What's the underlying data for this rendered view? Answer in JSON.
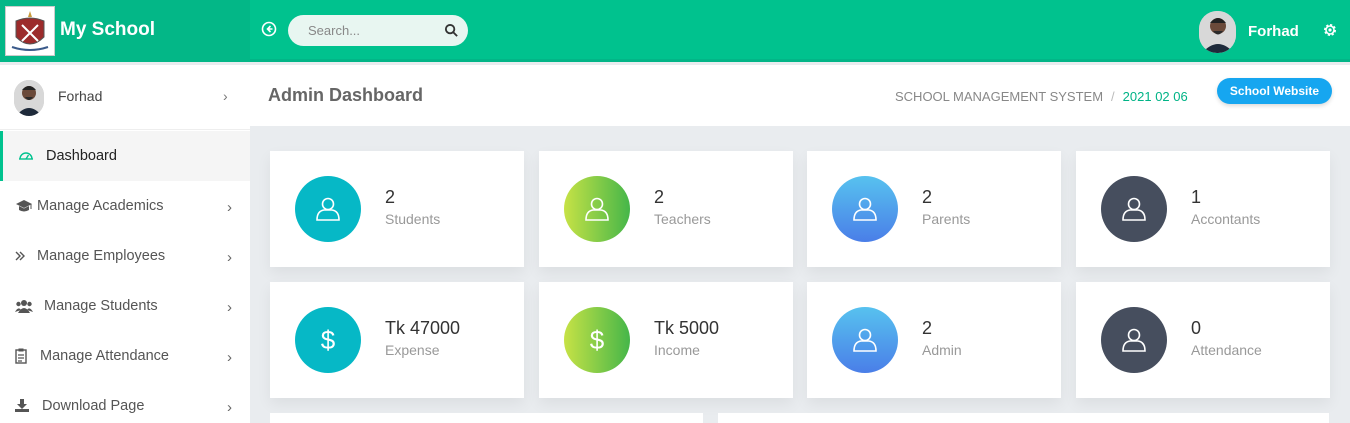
{
  "brand": {
    "name": "My School",
    "logo_icon": "school-crest-logo"
  },
  "search": {
    "placeholder": "Search..."
  },
  "user": {
    "name": "Forhad"
  },
  "sidebar": {
    "user_name": "Forhad",
    "items": [
      {
        "label": "Dashboard",
        "icon": "dashboard-gauge-icon",
        "active": true
      },
      {
        "label": "Manage Academics",
        "icon": "graduation-cap-icon"
      },
      {
        "label": "Manage Employees",
        "icon": "double-chevron-icon"
      },
      {
        "label": "Manage Students",
        "icon": "users-icon"
      },
      {
        "label": "Manage Attendance",
        "icon": "clipboard-icon"
      },
      {
        "label": "Download Page",
        "icon": "download-icon"
      }
    ]
  },
  "header": {
    "title": "Admin Dashboard",
    "breadcrumb_root": "SCHOOL MANAGEMENT SYSTEM",
    "breadcrumb_sep": "/",
    "date": "2021 02 06",
    "website_button": "School Website"
  },
  "cards": [
    {
      "value": "2",
      "label": "Students",
      "icon": "user-icon",
      "color": "#06b8c6"
    },
    {
      "value": "2",
      "label": "Teachers",
      "icon": "user-icon",
      "color": "#8ccd48"
    },
    {
      "value": "2",
      "label": "Parents",
      "icon": "user-icon",
      "color": "#5199ec"
    },
    {
      "value": "1",
      "label": "Accontants",
      "icon": "user-icon",
      "color": "#464e5e"
    },
    {
      "value": "Tk 47000",
      "label": "Expense",
      "icon": "dollar-icon",
      "glyph": "$",
      "color": "#06b8c6"
    },
    {
      "value": "Tk 5000",
      "label": "Income",
      "icon": "dollar-icon",
      "glyph": "$",
      "color": "#8ccd48"
    },
    {
      "value": "2",
      "label": "Admin",
      "icon": "user-icon",
      "color": "#5199ec"
    },
    {
      "value": "0",
      "label": "Attendance",
      "icon": "user-icon",
      "color": "#464e5e"
    }
  ],
  "colors": {
    "primary": "#00c28e",
    "button": "#16a6f0"
  }
}
